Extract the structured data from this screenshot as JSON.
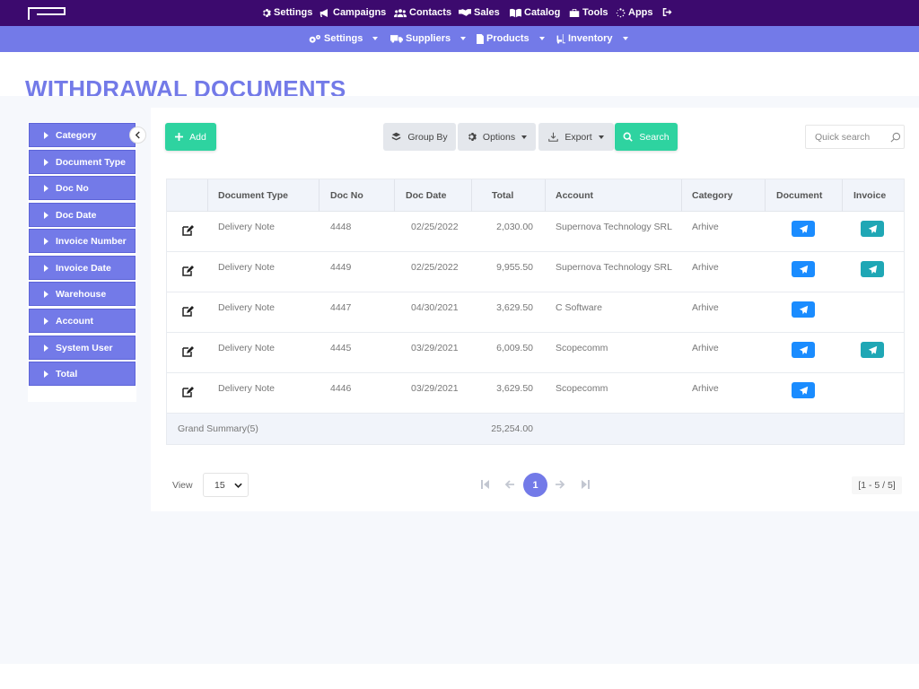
{
  "top_nav": [
    {
      "label": "Settings",
      "icon": "gear-icon"
    },
    {
      "label": "Campaigns",
      "icon": "megaphone-icon"
    },
    {
      "label": "Contacts",
      "icon": "users-icon"
    },
    {
      "label": "Sales",
      "icon": "handshake-icon"
    },
    {
      "label": "Catalog",
      "icon": "book-icon"
    },
    {
      "label": "Tools",
      "icon": "toolbox-icon"
    },
    {
      "label": "Apps",
      "icon": "spinner-icon"
    },
    {
      "label": "",
      "icon": "logout-icon"
    }
  ],
  "sub_nav": [
    {
      "label": "Settings",
      "icon": "gears-icon"
    },
    {
      "label": "Suppliers",
      "icon": "truck-icon"
    },
    {
      "label": "Products",
      "icon": "file-icon"
    },
    {
      "label": "Inventory",
      "icon": "forklift-icon"
    }
  ],
  "page": {
    "title": "WITHDRAWAL DOCUMENTS"
  },
  "filters": [
    "Category",
    "Document Type",
    "Doc No",
    "Doc Date",
    "Invoice Number",
    "Invoice Date",
    "Warehouse",
    "Account",
    "System User",
    "Total"
  ],
  "toolbar": {
    "add_label": "Add",
    "group_by_label": "Group By",
    "options_label": "Options",
    "export_label": "Export",
    "search_label": "Search",
    "quick_search_placeholder": "Quick search"
  },
  "table": {
    "columns": [
      "",
      "Document Type",
      "Doc No",
      "Doc Date",
      "Total",
      "Account",
      "Category",
      "Document",
      "Invoice"
    ],
    "rows": [
      {
        "type": "Delivery Note",
        "doc_no": "4448",
        "date": "02/25/2022",
        "total": "2,030.00",
        "account": "Supernova Technology SRL",
        "category": "Arhive",
        "has_invoice": true
      },
      {
        "type": "Delivery Note",
        "doc_no": "4449",
        "date": "02/25/2022",
        "total": "9,955.50",
        "account": "Supernova Technology SRL",
        "category": "Arhive",
        "has_invoice": true
      },
      {
        "type": "Delivery Note",
        "doc_no": "4447",
        "date": "04/30/2021",
        "total": "3,629.50",
        "account": "C Software",
        "category": "Arhive",
        "has_invoice": false
      },
      {
        "type": "Delivery Note",
        "doc_no": "4445",
        "date": "03/29/2021",
        "total": "6,009.50",
        "account": "Scopecomm",
        "category": "Arhive",
        "has_invoice": true
      },
      {
        "type": "Delivery Note",
        "doc_no": "4446",
        "date": "03/29/2021",
        "total": "3,629.50",
        "account": "Scopecomm",
        "category": "Arhive",
        "has_invoice": false
      }
    ],
    "summary_label": "Grand Summary(5)",
    "summary_total": "25,254.00"
  },
  "pagination": {
    "view_label": "View",
    "page_size": "15",
    "current_page": "1",
    "range": "[1 - 5 / 5]"
  },
  "colors": {
    "top_bar": "#3c0a6e",
    "sub_bar": "#737ae8",
    "accent_green": "#2ed3a0",
    "send_blue": "#1a8cff",
    "send_teal": "#1fa7b5"
  }
}
